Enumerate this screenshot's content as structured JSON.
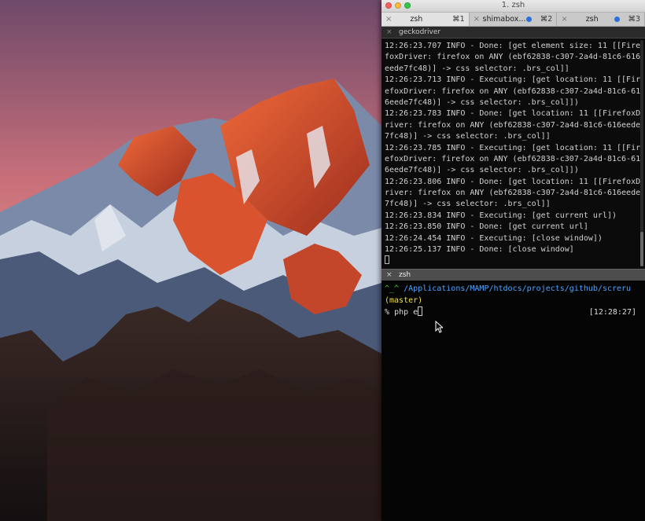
{
  "window": {
    "title": "1. zsh"
  },
  "tabs": [
    {
      "label": "zsh",
      "shortcut": "⌘1",
      "active": true,
      "dot": false
    },
    {
      "label": "shimabox...",
      "shortcut": "⌘2",
      "active": false,
      "dot": true
    },
    {
      "label": "zsh",
      "shortcut": "⌘3",
      "active": false,
      "dot": true
    }
  ],
  "pane_top": {
    "name": "geckodriver",
    "lines": [
      "12:26:23.707 INFO - Done: [get element size: 11 [[Fire",
      "foxDriver: firefox on ANY (ebf62838-c307-2a4d-81c6-616",
      "eede7fc48)] -> css selector: .brs_col]]",
      "12:26:23.713 INFO - Executing: [get location: 11 [[Fir",
      "efoxDriver: firefox on ANY (ebf62838-c307-2a4d-81c6-61",
      "6eede7fc48)] -> css selector: .brs_col]])",
      "12:26:23.783 INFO - Done: [get location: 11 [[FirefoxD",
      "river: firefox on ANY (ebf62838-c307-2a4d-81c6-616eede",
      "7fc48)] -> css selector: .brs_col]]",
      "12:26:23.785 INFO - Executing: [get location: 11 [[Fir",
      "efoxDriver: firefox on ANY (ebf62838-c307-2a4d-81c6-61",
      "6eede7fc48)] -> css selector: .brs_col]])",
      "12:26:23.806 INFO - Done: [get location: 11 [[FirefoxD",
      "river: firefox on ANY (ebf62838-c307-2a4d-81c6-616eede",
      "7fc48)] -> css selector: .brs_col]]",
      "12:26:23.834 INFO - Executing: [get current url])",
      "12:26:23.850 INFO - Done: [get current url]",
      "12:26:24.454 INFO - Executing: [close window])",
      "12:26:25.137 INFO - Done: [close window]"
    ]
  },
  "pane_bottom": {
    "name": "zsh",
    "smile": "^_^",
    "path": "/Applications/MAMP/htdocs/projects/github/screru",
    "branch": "(master)",
    "prompt_char": "%",
    "command": "php e",
    "right_time": "[12:28:27]"
  },
  "colors": {
    "smile": "#4fd13a",
    "path": "#4da3ff",
    "branch": "#f1e13b",
    "tab_dot": "#2b6fe0"
  }
}
